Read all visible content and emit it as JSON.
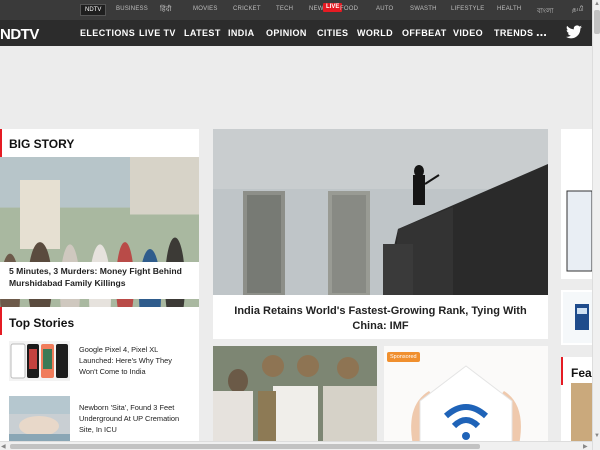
{
  "topbar": {
    "items": [
      "NDTV",
      "BUSINESS",
      "हिंदी",
      "MOVIES",
      "CRICKET",
      "TECH",
      "NEW",
      "FOOD",
      "AUTO",
      "SWASTH",
      "LIFESTYLE",
      "HEALTH",
      "বাংলা",
      "தமி"
    ],
    "live_badge": "LIVE"
  },
  "nav": {
    "logo": "NDTV",
    "items": [
      "ELECTIONS",
      "LIVE TV",
      "LATEST",
      "INDIA",
      "OPINION",
      "CITIES",
      "WORLD",
      "OFFBEAT",
      "VIDEO",
      "TRENDS"
    ],
    "more": "..."
  },
  "big_story": {
    "title": "BIG STORY",
    "headline": "5 Minutes, 3 Murders: Money Fight Behind Murshidabad Family Killings"
  },
  "top_stories": {
    "title": "Top Stories",
    "items": [
      {
        "headline": "Google Pixel 4, Pixel XL Launched: Here's Why They Won't Come to India"
      },
      {
        "headline": "Newborn 'Sita', Found 3 Feet Underground At UP Cremation Site, In ICU"
      }
    ]
  },
  "hero": {
    "headline": "India Retains World's Fastest-Growing Rank, Tying With China: IMF"
  },
  "sponsored": {
    "label": "Sponsored"
  },
  "right_col": {
    "partial_title": "Fea"
  }
}
